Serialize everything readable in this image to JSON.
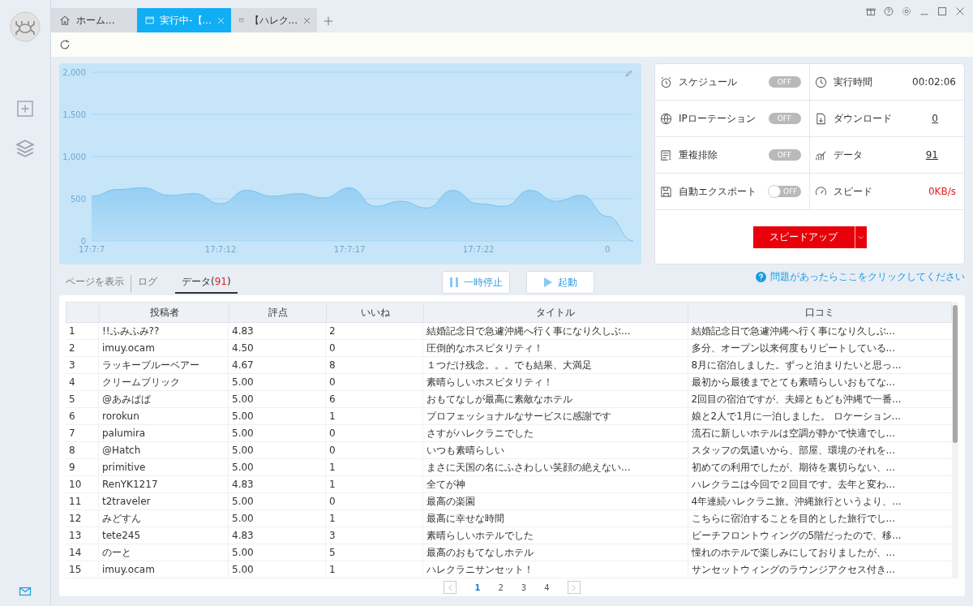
{
  "tabs": [
    {
      "kind": "home",
      "label": "ホーム...",
      "selected": false,
      "closable": false
    },
    {
      "kind": "page",
      "label": "実行中-【...",
      "selected": true,
      "closable": true
    },
    {
      "kind": "page",
      "label": "【ハレク...",
      "selected": false,
      "closable": true
    }
  ],
  "chart": {
    "chart_data": {
      "type": "area",
      "categories": [
        "17:7:7",
        null,
        null,
        null,
        null,
        "17:7:12",
        null,
        null,
        null,
        null,
        "17:7:17",
        null,
        null,
        null,
        null,
        "17:7:22",
        null,
        null,
        null,
        null,
        "0",
        null
      ],
      "series": [
        {
          "color": "#90cdf4",
          "values": [
            530,
            610,
            630,
            540,
            560,
            440,
            600,
            530,
            560,
            510,
            630,
            410,
            470,
            390,
            600,
            440,
            410,
            600,
            470,
            540,
            290,
            0
          ]
        }
      ],
      "ylim": [
        0,
        2000
      ],
      "grid": true,
      "yticks": [
        {
          "value": 0,
          "label": "0"
        },
        {
          "value": 500,
          "label": "500"
        },
        {
          "value": 1000,
          "label": "1,000"
        },
        {
          "value": 1500,
          "label": "1,500"
        },
        {
          "value": 2000,
          "label": "2,000"
        }
      ]
    }
  },
  "stats": [
    {
      "kind": "toggle",
      "label": "スケジュール",
      "state": "OFF",
      "on": false
    },
    {
      "kind": "value",
      "label": "実行時間",
      "value": "00:02:06"
    },
    {
      "kind": "toggle",
      "label": "IPローテーション",
      "state": "OFF",
      "on": false
    },
    {
      "kind": "link",
      "label": "ダウンロード",
      "value": "0"
    },
    {
      "kind": "toggle",
      "label": "重複排除",
      "state": "OFF",
      "on": false
    },
    {
      "kind": "link",
      "label": "データ",
      "value": "91"
    },
    {
      "kind": "switch",
      "label": "自動エクスポート",
      "state": "OFF",
      "on": false
    },
    {
      "kind": "alert",
      "label": "スピード",
      "value": "0KB/s"
    }
  ],
  "speed_button": {
    "label": "スピードアップ"
  },
  "view_tabs": [
    {
      "label": "ページを表示",
      "selected": false
    },
    {
      "label": "ログ",
      "selected": false
    },
    {
      "label": "データ(",
      "count": "91",
      "suffix": ")",
      "selected": true
    }
  ],
  "controls": [
    {
      "kind": "pause",
      "label": "一時停止"
    },
    {
      "kind": "play",
      "label": "起動"
    }
  ],
  "help_link": "問題があったらここをクリックしてください",
  "table": {
    "columns": [
      "",
      "投稿者",
      "評点",
      "いいね",
      "タイトル",
      "口コミ"
    ],
    "rows": [
      [
        "1",
        "!!ふみふみ??",
        "4.83",
        "2",
        "結婚記念日で急遽沖縄へ行く事になり久しぶ...",
        "結婚記念日で急遽沖縄へ行く事になり久しぶ..."
      ],
      [
        "2",
        "imuy.ocam",
        "4.50",
        "0",
        "圧倒的なホスピタリティ！",
        "多分、オープン以来何度もリピートしている..."
      ],
      [
        "3",
        "ラッキーブルーベアー",
        "4.67",
        "8",
        "１つだけ残念。。。でも結果、大満足",
        "8月に宿泊しました。ずっと泊まりたいと思っ..."
      ],
      [
        "4",
        "クリームブリック",
        "5.00",
        "0",
        "素晴らしいホスピタリティ！",
        "最初から最後までとても素晴らしいおもてな..."
      ],
      [
        "5",
        "@あみぱぱ",
        "5.00",
        "6",
        "おもてなしが最高に素敵なホテル",
        "2回目の宿泊ですが、夫婦ともども沖縄で一番..."
      ],
      [
        "6",
        "rorokun",
        "5.00",
        "1",
        "プロフェッショナルなサービスに感謝です",
        "娘と2人で1月に一泊しました。 ロケーション..."
      ],
      [
        "7",
        "palumira",
        "5.00",
        "0",
        "さすがハレクラニでした",
        "流石に新しいホテルは空調が静かで快適でし..."
      ],
      [
        "8",
        "@Hatch",
        "5.00",
        "0",
        "いつも素晴らしい",
        "スタッフの気遣いから、部屋、環境のそれを..."
      ],
      [
        "9",
        "primitive",
        "5.00",
        "1",
        "まさに天国の名にふさわしい笑顔の絶えない...",
        "初めての利用でしたが、期待を裏切らない、..."
      ],
      [
        "10",
        "RenYK1217",
        "4.83",
        "1",
        "全てが神",
        "ハレクラニは今回で２回目です。去年と変わ..."
      ],
      [
        "11",
        "t2traveler",
        "5.00",
        "0",
        "最高の楽園",
        "4年連続ハレクラニ旅。沖縄旅行というより、..."
      ],
      [
        "12",
        "みどすん",
        "5.00",
        "1",
        "最高に幸せな時間",
        "こちらに宿泊することを目的とした旅行でし..."
      ],
      [
        "13",
        "tete245",
        "4.83",
        "3",
        "素晴らしいホテルでした",
        "ビーチフロントウィングの5階だったので、移..."
      ],
      [
        "14",
        "のーと",
        "5.00",
        "5",
        "最高のおもてなしホテル",
        "憧れのホテルで楽しみにしておりましたが、..."
      ],
      [
        "15",
        "imuy.ocam",
        "5.00",
        "1",
        "ハレクラニサンセット！",
        "サンセットウィングのラウンジアクセス付き..."
      ]
    ]
  },
  "pagination": [
    {
      "label": "1",
      "selected": true
    },
    {
      "label": "2",
      "selected": false
    },
    {
      "label": "3",
      "selected": false
    },
    {
      "label": "4",
      "selected": false
    }
  ]
}
